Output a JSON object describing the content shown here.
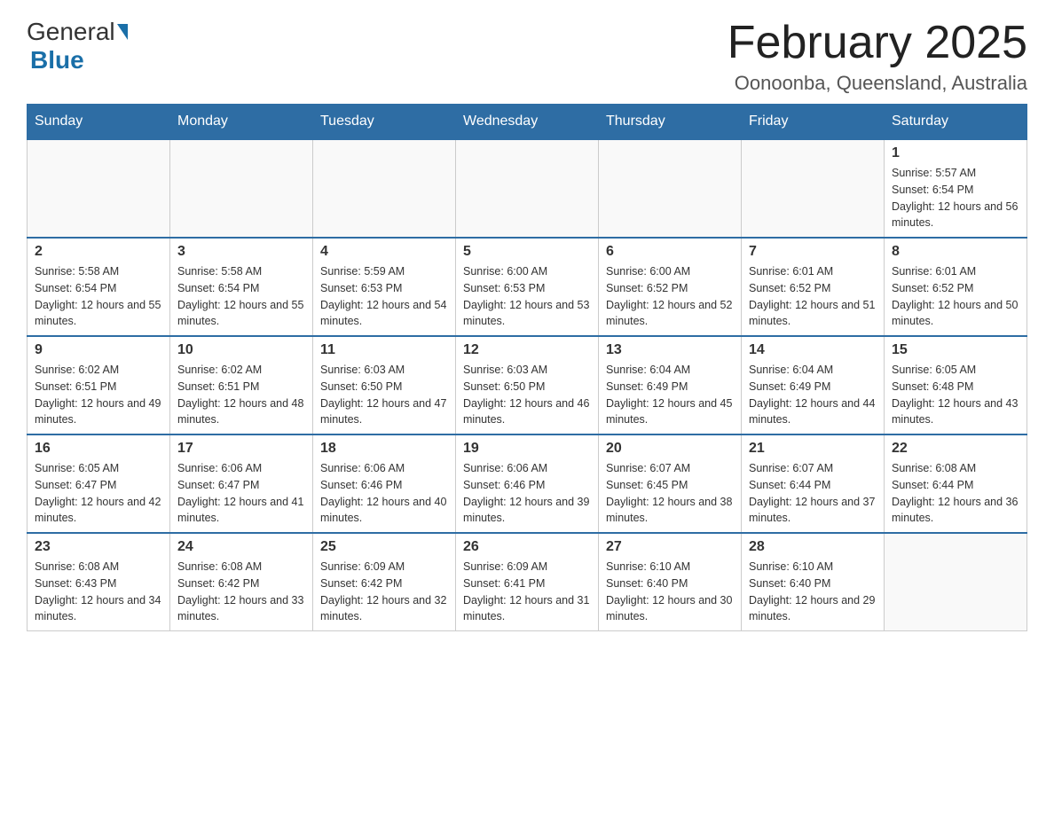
{
  "logo": {
    "general": "General",
    "blue": "Blue"
  },
  "header": {
    "title": "February 2025",
    "location": "Oonoonba, Queensland, Australia"
  },
  "weekdays": [
    "Sunday",
    "Monday",
    "Tuesday",
    "Wednesday",
    "Thursday",
    "Friday",
    "Saturday"
  ],
  "weeks": [
    [
      {
        "day": "",
        "info": ""
      },
      {
        "day": "",
        "info": ""
      },
      {
        "day": "",
        "info": ""
      },
      {
        "day": "",
        "info": ""
      },
      {
        "day": "",
        "info": ""
      },
      {
        "day": "",
        "info": ""
      },
      {
        "day": "1",
        "info": "Sunrise: 5:57 AM\nSunset: 6:54 PM\nDaylight: 12 hours and 56 minutes."
      }
    ],
    [
      {
        "day": "2",
        "info": "Sunrise: 5:58 AM\nSunset: 6:54 PM\nDaylight: 12 hours and 55 minutes."
      },
      {
        "day": "3",
        "info": "Sunrise: 5:58 AM\nSunset: 6:54 PM\nDaylight: 12 hours and 55 minutes."
      },
      {
        "day": "4",
        "info": "Sunrise: 5:59 AM\nSunset: 6:53 PM\nDaylight: 12 hours and 54 minutes."
      },
      {
        "day": "5",
        "info": "Sunrise: 6:00 AM\nSunset: 6:53 PM\nDaylight: 12 hours and 53 minutes."
      },
      {
        "day": "6",
        "info": "Sunrise: 6:00 AM\nSunset: 6:52 PM\nDaylight: 12 hours and 52 minutes."
      },
      {
        "day": "7",
        "info": "Sunrise: 6:01 AM\nSunset: 6:52 PM\nDaylight: 12 hours and 51 minutes."
      },
      {
        "day": "8",
        "info": "Sunrise: 6:01 AM\nSunset: 6:52 PM\nDaylight: 12 hours and 50 minutes."
      }
    ],
    [
      {
        "day": "9",
        "info": "Sunrise: 6:02 AM\nSunset: 6:51 PM\nDaylight: 12 hours and 49 minutes."
      },
      {
        "day": "10",
        "info": "Sunrise: 6:02 AM\nSunset: 6:51 PM\nDaylight: 12 hours and 48 minutes."
      },
      {
        "day": "11",
        "info": "Sunrise: 6:03 AM\nSunset: 6:50 PM\nDaylight: 12 hours and 47 minutes."
      },
      {
        "day": "12",
        "info": "Sunrise: 6:03 AM\nSunset: 6:50 PM\nDaylight: 12 hours and 46 minutes."
      },
      {
        "day": "13",
        "info": "Sunrise: 6:04 AM\nSunset: 6:49 PM\nDaylight: 12 hours and 45 minutes."
      },
      {
        "day": "14",
        "info": "Sunrise: 6:04 AM\nSunset: 6:49 PM\nDaylight: 12 hours and 44 minutes."
      },
      {
        "day": "15",
        "info": "Sunrise: 6:05 AM\nSunset: 6:48 PM\nDaylight: 12 hours and 43 minutes."
      }
    ],
    [
      {
        "day": "16",
        "info": "Sunrise: 6:05 AM\nSunset: 6:47 PM\nDaylight: 12 hours and 42 minutes."
      },
      {
        "day": "17",
        "info": "Sunrise: 6:06 AM\nSunset: 6:47 PM\nDaylight: 12 hours and 41 minutes."
      },
      {
        "day": "18",
        "info": "Sunrise: 6:06 AM\nSunset: 6:46 PM\nDaylight: 12 hours and 40 minutes."
      },
      {
        "day": "19",
        "info": "Sunrise: 6:06 AM\nSunset: 6:46 PM\nDaylight: 12 hours and 39 minutes."
      },
      {
        "day": "20",
        "info": "Sunrise: 6:07 AM\nSunset: 6:45 PM\nDaylight: 12 hours and 38 minutes."
      },
      {
        "day": "21",
        "info": "Sunrise: 6:07 AM\nSunset: 6:44 PM\nDaylight: 12 hours and 37 minutes."
      },
      {
        "day": "22",
        "info": "Sunrise: 6:08 AM\nSunset: 6:44 PM\nDaylight: 12 hours and 36 minutes."
      }
    ],
    [
      {
        "day": "23",
        "info": "Sunrise: 6:08 AM\nSunset: 6:43 PM\nDaylight: 12 hours and 34 minutes."
      },
      {
        "day": "24",
        "info": "Sunrise: 6:08 AM\nSunset: 6:42 PM\nDaylight: 12 hours and 33 minutes."
      },
      {
        "day": "25",
        "info": "Sunrise: 6:09 AM\nSunset: 6:42 PM\nDaylight: 12 hours and 32 minutes."
      },
      {
        "day": "26",
        "info": "Sunrise: 6:09 AM\nSunset: 6:41 PM\nDaylight: 12 hours and 31 minutes."
      },
      {
        "day": "27",
        "info": "Sunrise: 6:10 AM\nSunset: 6:40 PM\nDaylight: 12 hours and 30 minutes."
      },
      {
        "day": "28",
        "info": "Sunrise: 6:10 AM\nSunset: 6:40 PM\nDaylight: 12 hours and 29 minutes."
      },
      {
        "day": "",
        "info": ""
      }
    ]
  ]
}
